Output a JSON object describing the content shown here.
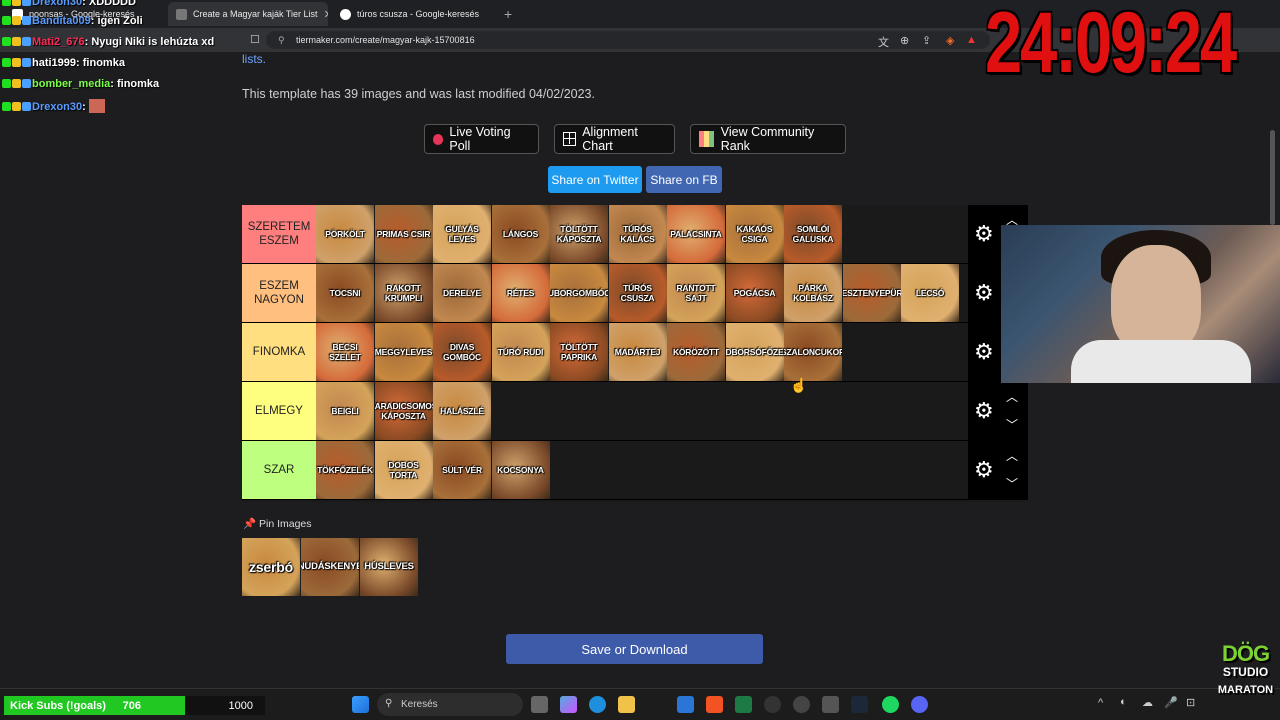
{
  "browser": {
    "tabs": [
      {
        "label": "poonsas - Google-keresés",
        "active": false
      },
      {
        "label": "Create a Magyar kaják Tier List",
        "active": true
      },
      {
        "label": "túros csusza - Google-keresés",
        "active": false
      }
    ],
    "new_tab_icon": "+",
    "url": "tiermaker.com/create/magyar-kajk-15700816"
  },
  "page": {
    "lists_link": "lists.",
    "template_info": "This template has 39 images and was last modified 04/02/2023.",
    "buttons": {
      "live_voting": "Live Voting Poll",
      "alignment": "Alignment Chart",
      "community": "View Community Rank",
      "twitter": "Share on Twitter",
      "fb": "Share on FB"
    },
    "tiers": [
      {
        "label": "SZERETEM ESZEM",
        "color": "#ff7f7f",
        "items": [
          "PÖRKÖLT",
          "PRIMAS CSIR",
          "GULYÁS LEVES",
          "LÁNGOS",
          "TÖLTÖTT KÁPOSZTA",
          "TÚRÓS KALÁCS",
          "PALACSINTA",
          "KAKAÓS CSIGA",
          "SOMLÓI GALUSKA"
        ]
      },
      {
        "label": "ESZEM NAGYON",
        "color": "#ffbf7f",
        "items": [
          "TOCSNI",
          "RAKOTT KRUMPLI",
          "DERELYE",
          "RÉTES",
          "UBORGOMBÓC",
          "TÚRÓS CSUSZA",
          "RANTOTT SAJT",
          "POGÁCSA",
          "PÁRKA KOLBÁSZ",
          "GESZTENYEPÜRÉ",
          "LECSÓ"
        ]
      },
      {
        "label": "FINOMKA",
        "color": "#ffdf7f",
        "items": [
          "BECSI SZELET",
          "MEGGYLEVES",
          "DIVAS GOMBÓC",
          "TÚRÓ RUDI",
          "TÖLTÖTT PAPRIKA",
          "MADÁRTEJ",
          "KÖRÖZÖTT",
          "ZÖLDBORSÓFŐZELÉK",
          "SZALONCUKOR"
        ]
      },
      {
        "label": "ELMEGY",
        "color": "#ffff7f",
        "items": [
          "BEIGLI",
          "VARADICSOMOS KÁPOSZTA",
          "HALÁSZLÉ"
        ]
      },
      {
        "label": "SZAR",
        "color": "#bfff7f",
        "items": [
          "TÖKFŐZELÉK",
          "DOBOS TORTA",
          "SÜLT VÉR",
          "KOCSONYA"
        ]
      }
    ],
    "pin_label": "Pin Images",
    "pinned": [
      "zserbó",
      "NUDÁSKENYÉ",
      "HÚSLEVES"
    ],
    "save_button": "Save or Download"
  },
  "chat": [
    {
      "user": "Drexon30",
      "msg": "XDDDDD",
      "color": "#5b9bff"
    },
    {
      "user": "Bandita009",
      "msg": "igen Zoli",
      "color": "#5b9bff"
    },
    {
      "user": "Mati2_676",
      "msg": "Nyugi Niki is lehúzta xd",
      "color": "#ff2a55"
    },
    {
      "user": "hati1999",
      "msg": "finomka",
      "color": "#ffffff"
    },
    {
      "user": "bomber_media",
      "msg": "finomka",
      "color": "#7cff4a"
    },
    {
      "user": "Drexon30",
      "msg": "",
      "color": "#5b9bff"
    }
  ],
  "overlay": {
    "timer": "24:09:24",
    "kick_subs_label": "Kick Subs (!goals)",
    "kick_subs_count": "706",
    "kick_subs_goal": "1000",
    "logo_line1": "DÖG",
    "logo_line2": "STUDIO",
    "logo_line3": "MARATON"
  },
  "taskbar": {
    "search_placeholder": "Keresés"
  }
}
